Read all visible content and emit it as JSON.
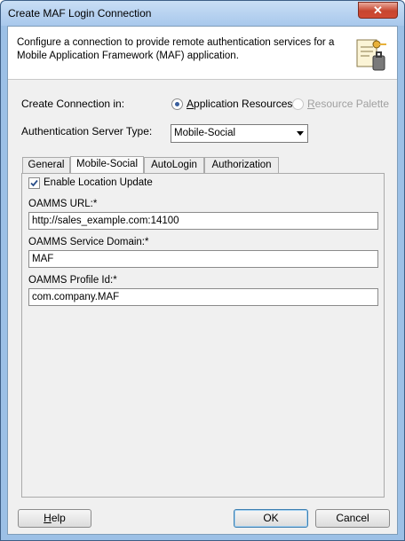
{
  "window": {
    "title": "Create MAF Login Connection",
    "close_label": "✕"
  },
  "header": {
    "description": "Configure a connection to provide remote authentication services for a Mobile Application Framework (MAF) application.",
    "icon": "connection-wizard-icon"
  },
  "create_in": {
    "label": "Create Connection in:",
    "options": [
      {
        "label": "Application Resources",
        "selected": true,
        "enabled": true
      },
      {
        "label": "Resource Palette",
        "selected": false,
        "enabled": false
      }
    ]
  },
  "auth_server": {
    "label": "Authentication Server Type:",
    "value": "Mobile-Social"
  },
  "tabs": [
    {
      "label": "General"
    },
    {
      "label": "Mobile-Social",
      "active": true
    },
    {
      "label": "AutoLogin"
    },
    {
      "label": "Authorization"
    }
  ],
  "mobile_social": {
    "enable_location": {
      "label": "Enable Location Update",
      "checked": true
    },
    "oamms_url": {
      "label": "OAMMS URL:*",
      "value": "http://sales_example.com:14100"
    },
    "service_domain": {
      "label": "OAMMS Service Domain:*",
      "value": "MAF"
    },
    "profile_id": {
      "label": "OAMMS Profile Id:*",
      "value": "com.company.MAF"
    }
  },
  "buttons": {
    "help": "Help",
    "ok": "OK",
    "cancel": "Cancel"
  },
  "colors": {
    "accent": "#3a5f9e",
    "titlebar": "#a8c8ec",
    "close": "#c7452f"
  }
}
